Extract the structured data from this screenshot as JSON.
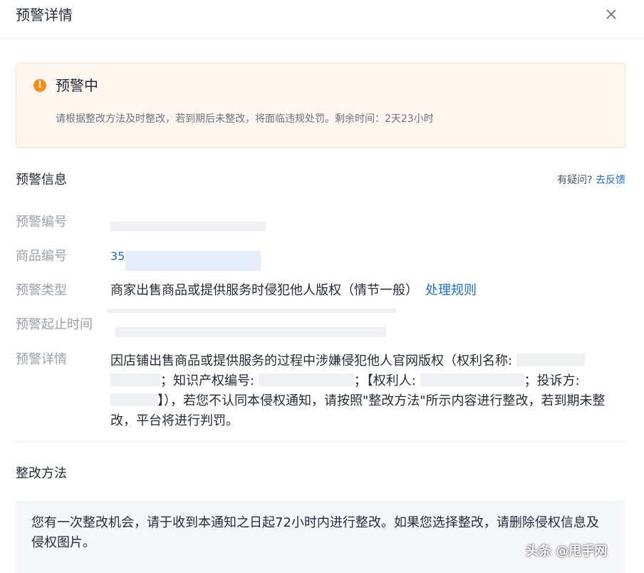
{
  "header": {
    "title": "预警详情",
    "close_icon": "close-icon"
  },
  "alert": {
    "icon": "warning-icon",
    "icon_glyph": "!",
    "title": "预警中",
    "description": "请根据整改方法及时整改，若到期后未整改，将面临违规处罚。剩余时间：2天23小时",
    "accent_color": "#fa8c16"
  },
  "info": {
    "section_title": "预警信息",
    "help_question": "有疑问?",
    "help_link": "去反馈",
    "fields": {
      "alert_id_label": "预警编号",
      "product_id_label": "商品编号",
      "product_id_value": "35",
      "type_label": "预警类型",
      "type_value": "商家出售商品或提供服务时侵犯他人版权（情节一般）",
      "type_link": "处理规则",
      "period_label": "预警起止时间",
      "detail_label": "预警详情"
    },
    "detail": {
      "part1": "因店铺出售商品或提供服务的过程中涉嫌侵犯他人官网版权（权利名称: ",
      "part2": "；知识产权编号: ",
      "part3": "；【权利人: ",
      "part4": "；投诉方: ",
      "part5": "】），若您不认同本侵权通知，请按照\"整改方法\"所示内容进行整改，若到期未整改，平台将进行判罚。"
    }
  },
  "method": {
    "section_title": "整改方法",
    "text": "您有一次整改机会，请于收到本通知之日起72小时内进行整改。如果您选择整改，请删除侵权信息及侵权图片。"
  },
  "watermark": "头条 @甩手网"
}
